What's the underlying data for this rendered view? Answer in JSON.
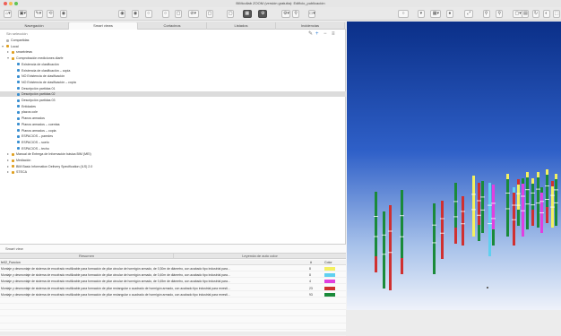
{
  "window": {
    "title": "BIMcollab ZOOM (versión gratuita): Edificio_publicación"
  },
  "toolbar": {
    "buttons": [
      "⌂▾",
      "▣▾",
      "✎▾",
      "⟲",
      "◉",
      "◉",
      "◉",
      "○",
      "○",
      "▢",
      "⊘▾",
      "▢",
      "▢",
      "▦",
      "⚙",
      "⚙▾",
      "⚲",
      "▭▾",
      "○",
      "▾",
      "▦▾",
      "●",
      "⤢",
      "⚲",
      "⚲",
      "▢▾",
      "▤",
      "↻",
      "◐",
      "⬚"
    ]
  },
  "tabs": [
    {
      "label": "Navegación",
      "active": false
    },
    {
      "label": "Smart views",
      "active": true
    },
    {
      "label": "Cortacinos",
      "active": false
    },
    {
      "label": "Listados",
      "active": false
    },
    {
      "label": "Incidencias",
      "active": false
    }
  ],
  "viewbar": {
    "label": "Sin selección",
    "add_icon": "+",
    "remove_icon": "−",
    "menu_icon": "≡",
    "edit_icon": "✎"
  },
  "tree": [
    {
      "label": "Compartidas",
      "indent": 0,
      "expander": "",
      "color": "#b0b0b0"
    },
    {
      "label": "Local",
      "indent": 0,
      "expander": "▾",
      "color": "#e0a020"
    },
    {
      "label": "smartviews",
      "indent": 1,
      "expander": "▸",
      "color": "#e0a020"
    },
    {
      "label": "Comprobación mediciones diarfe",
      "indent": 1,
      "expander": "▾",
      "color": "#e0a020"
    },
    {
      "label": "Existencia de clasificación",
      "indent": 2,
      "expander": "",
      "color": "#3a8fd0"
    },
    {
      "label": "Existencia de clasificación – copia",
      "indent": 2,
      "expander": "",
      "color": "#3a8fd0"
    },
    {
      "label": "NO Existencia de clasificación",
      "indent": 2,
      "expander": "",
      "color": "#3a8fd0"
    },
    {
      "label": "NO Existencia de clasificación – copia",
      "indent": 2,
      "expander": "",
      "color": "#3a8fd0"
    },
    {
      "label": "Descripción partidas 01",
      "indent": 2,
      "expander": "",
      "color": "#3a8fd0"
    },
    {
      "label": "Descripción partidas 02",
      "indent": 2,
      "expander": "",
      "color": "#3a8fd0",
      "selected": true
    },
    {
      "label": "Descripción partidas 03",
      "indent": 2,
      "expander": "",
      "color": "#3a8fd0"
    },
    {
      "label": "Entidades",
      "indent": 2,
      "expander": "",
      "color": "#3a8fd0"
    },
    {
      "label": "plazos cole",
      "indent": 2,
      "expander": "",
      "color": "#3a8fd0"
    },
    {
      "label": "Planos armados",
      "indent": 2,
      "expander": "",
      "color": "#3a8fd0"
    },
    {
      "label": "Planos armados – cuentas",
      "indent": 2,
      "expander": "",
      "color": "#3a8fd0"
    },
    {
      "label": "Planos armados – copia",
      "indent": 2,
      "expander": "",
      "color": "#3a8fd0"
    },
    {
      "label": "ESPACIOS – paredes",
      "indent": 2,
      "expander": "",
      "color": "#3a8fd0"
    },
    {
      "label": "ESPACIOS – suelo",
      "indent": 2,
      "expander": "",
      "color": "#3a8fd0"
    },
    {
      "label": "ESPACIOS – techo",
      "indent": 2,
      "expander": "",
      "color": "#3a8fd0"
    },
    {
      "label": "Manual de Entrega de Información básica BIM (MEI)",
      "indent": 1,
      "expander": "▸",
      "color": "#e0a020"
    },
    {
      "label": "Mediación",
      "indent": 1,
      "expander": "▸",
      "color": "#e0a020"
    },
    {
      "label": "BIM Basic Information Delivery Specification (ILS) 2.0",
      "indent": 1,
      "expander": "▸",
      "color": "#e0a020"
    },
    {
      "label": "STECA",
      "indent": 1,
      "expander": "▸",
      "color": "#e0a020"
    }
  ],
  "smart_view_panel": {
    "header": "Smart view",
    "subtabs": [
      "Resumen",
      "Leyenda de auto color"
    ],
    "columns": {
      "name": "fe02_Funcion",
      "count": "#",
      "color": "Color"
    },
    "rows": [
      {
        "desc": "Montaje y desmontaje de sistema de encofrado reutilizable para formación de pilar circular de hormigón armado, de 0,30m de diámetro, con acabado tipo industrial para...",
        "count": "8",
        "color": "#f4f060"
      },
      {
        "desc": "Montaje y desmontaje de sistema de encofrado reutilizable para formación de pilar circular de hormigón armado, de 0,40m de diámetro, con acabado tipo industrial para...",
        "count": "8",
        "color": "#5fd0f0"
      },
      {
        "desc": "Montaje y desmontaje de sistema de encofrado reutilizable para formación de pilar circular de hormigón armado, de 0,45m de diámetro, con acabado tipo industrial para...",
        "count": "4",
        "color": "#e040e0"
      },
      {
        "desc": "Montaje y desmontaje de sistema de encofrado reutilizable para formación de pilar rectangular o cuadrado de hormigón armado, con acabado tipo industrial para revesti...",
        "count": "23",
        "color": "#d03030"
      },
      {
        "desc": "Montaje y desmontaje de sistema de encofrado reutilizable para formación de pilar rectangular o cuadrado de hormigón armado, con acabado tipo industrial para revesti...",
        "count": "93",
        "color": "#1a8a3a"
      }
    ]
  },
  "viewport": {
    "column_colors": [
      "#1a8a3a",
      "#d03030",
      "#e040e0",
      "#f4f060",
      "#5fd0f0"
    ]
  }
}
